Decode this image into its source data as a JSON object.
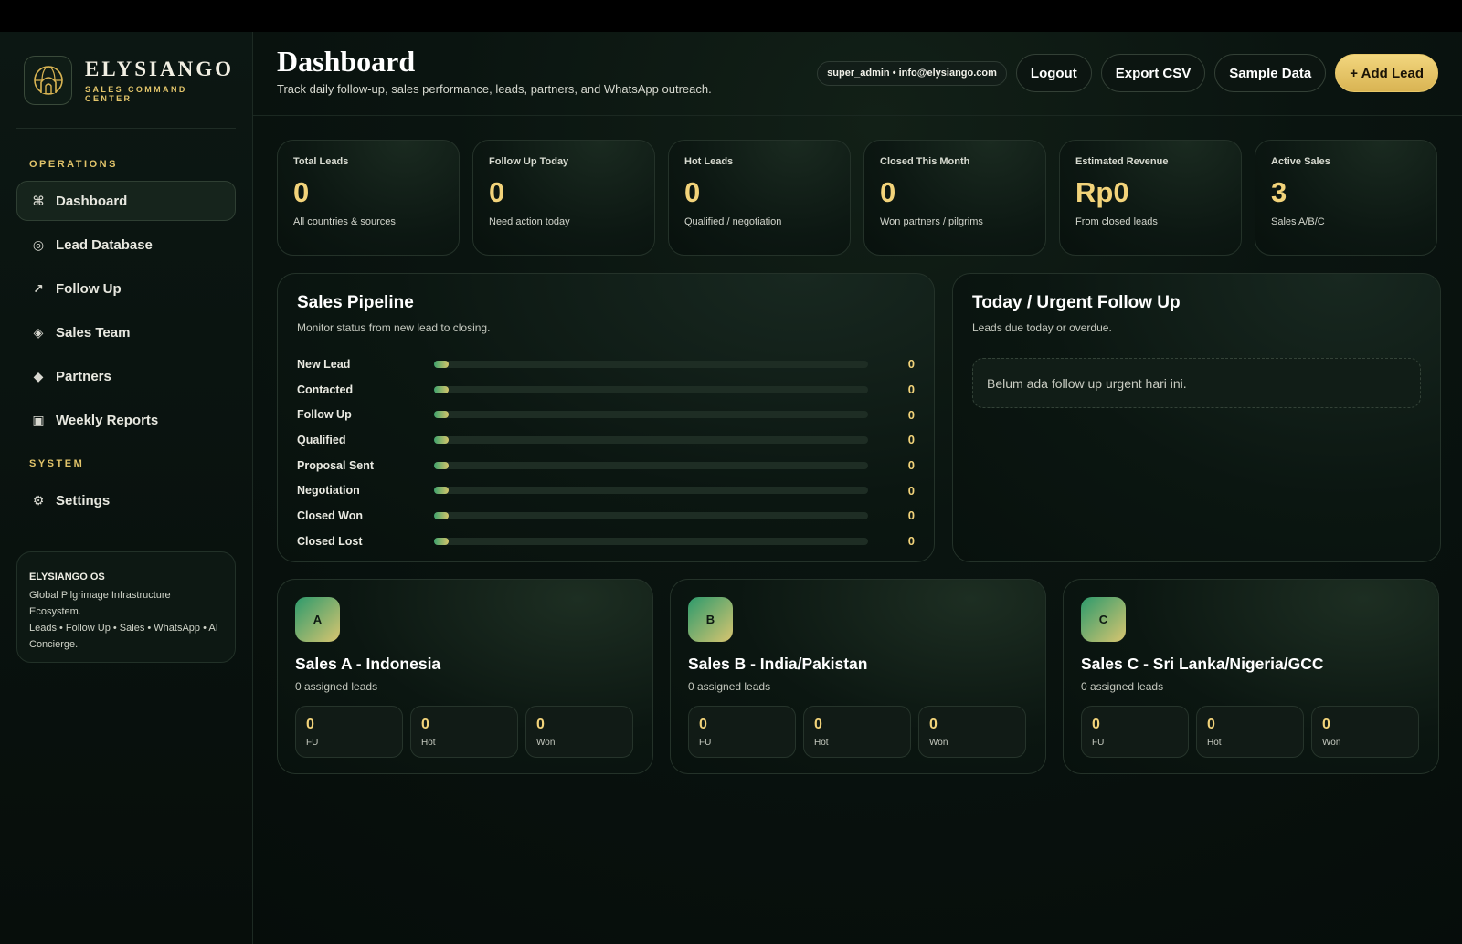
{
  "brand": {
    "name": "ELYSIANGO",
    "subtitle": "SALES COMMAND CENTER"
  },
  "sidebar": {
    "operations_label": "OPERATIONS",
    "system_label": "SYSTEM",
    "items": [
      {
        "label": "Dashboard",
        "icon": "command-icon"
      },
      {
        "label": "Lead Database",
        "icon": "circle-target-icon"
      },
      {
        "label": "Follow Up",
        "icon": "arrow-up-right-icon"
      },
      {
        "label": "Sales Team",
        "icon": "diamond-outline-icon"
      },
      {
        "label": "Partners",
        "icon": "diamond-solid-icon"
      },
      {
        "label": "Weekly Reports",
        "icon": "square-box-icon"
      }
    ],
    "system_items": [
      {
        "label": "Settings",
        "icon": "gear-icon"
      }
    ],
    "info": {
      "title": "ELYSIANGO OS",
      "line1": "Global Pilgrimage Infrastructure Ecosystem.",
      "line2": "Leads • Follow Up • Sales • WhatsApp • AI Concierge."
    }
  },
  "header": {
    "title": "Dashboard",
    "subtitle": "Track daily follow-up, sales performance, leads, partners, and WhatsApp outreach.",
    "user": "super_admin • info@elysiango.com",
    "logout": "Logout",
    "export": "Export CSV",
    "sample": "Sample Data",
    "add_lead": "+ Add Lead"
  },
  "stats": [
    {
      "label": "Total Leads",
      "value": "0",
      "desc": "All countries & sources"
    },
    {
      "label": "Follow Up Today",
      "value": "0",
      "desc": "Need action today"
    },
    {
      "label": "Hot Leads",
      "value": "0",
      "desc": "Qualified / negotiation"
    },
    {
      "label": "Closed This Month",
      "value": "0",
      "desc": "Won partners / pilgrims"
    },
    {
      "label": "Estimated Revenue",
      "value": "Rp0",
      "desc": "From closed leads"
    },
    {
      "label": "Active Sales",
      "value": "3",
      "desc": "Sales A/B/C"
    }
  ],
  "pipeline": {
    "title": "Sales Pipeline",
    "subtitle": "Monitor status from new lead to closing.",
    "stages": [
      {
        "label": "New Lead",
        "count": "0",
        "fraction": 0
      },
      {
        "label": "Contacted",
        "count": "0",
        "fraction": 0
      },
      {
        "label": "Follow Up",
        "count": "0",
        "fraction": 0
      },
      {
        "label": "Qualified",
        "count": "0",
        "fraction": 0
      },
      {
        "label": "Proposal Sent",
        "count": "0",
        "fraction": 0
      },
      {
        "label": "Negotiation",
        "count": "0",
        "fraction": 0
      },
      {
        "label": "Closed Won",
        "count": "0",
        "fraction": 0
      },
      {
        "label": "Closed Lost",
        "count": "0",
        "fraction": 0
      }
    ]
  },
  "urgent": {
    "title": "Today / Urgent Follow Up",
    "subtitle": "Leads due today or overdue.",
    "empty": "Belum ada follow up urgent hari ini."
  },
  "team": [
    {
      "initial": "A",
      "name": "Sales A - Indonesia",
      "assigned": "0 assigned leads",
      "fu": "0",
      "hot": "0",
      "won": "0"
    },
    {
      "initial": "B",
      "name": "Sales B - India/Pakistan",
      "assigned": "0 assigned leads",
      "fu": "0",
      "hot": "0",
      "won": "0"
    },
    {
      "initial": "C",
      "name": "Sales C - Sri Lanka/Nigeria/GCC",
      "assigned": "0 assigned leads",
      "fu": "0",
      "hot": "0",
      "won": "0"
    }
  ],
  "team_labels": {
    "fu": "FU",
    "hot": "Hot",
    "won": "Won"
  },
  "colors": {
    "accent_gold": "#f2d37a",
    "background": "#06100c",
    "bar_start": "#3fa36d",
    "bar_end": "#d6c56b"
  }
}
